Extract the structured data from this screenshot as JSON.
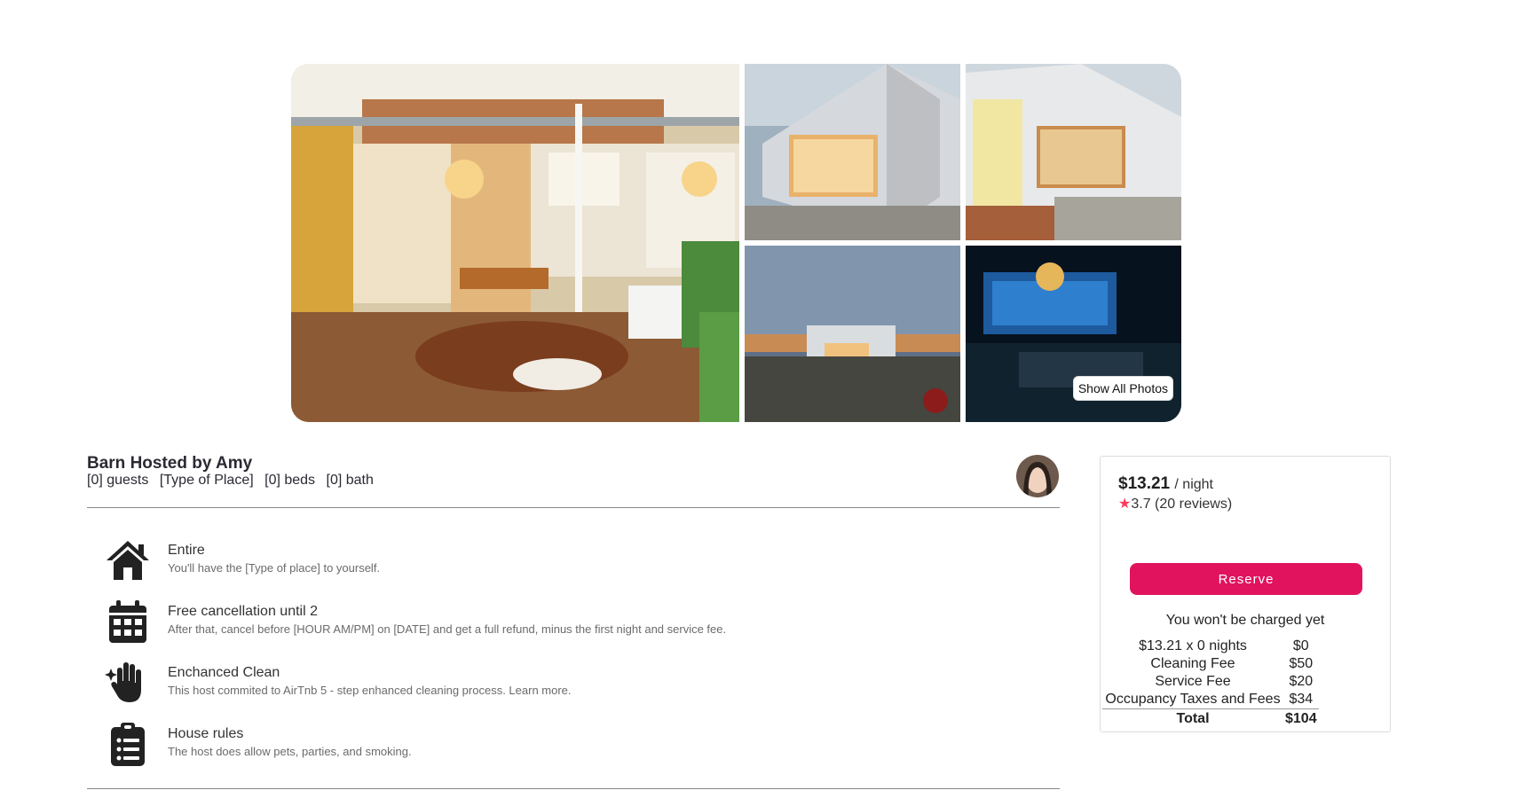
{
  "gallery": {
    "show_all_label": "Show All Photos"
  },
  "listing": {
    "title": "Barn Hosted by Amy",
    "details": [
      "[0] guests",
      "[Type of Place]",
      "[0] beds",
      "[0] bath"
    ]
  },
  "features": [
    {
      "icon": "house-icon",
      "title": "Entire",
      "desc": "You'll have the [Type of place] to yourself."
    },
    {
      "icon": "calendar-icon",
      "title": "Free cancellation until 2",
      "desc": "After that, cancel before [HOUR AM/PM] on [DATE] and get a full refund, minus the first night and service fee."
    },
    {
      "icon": "sparkle-hand-icon",
      "title": "Enchanced Clean",
      "desc": "This host commited to AirTnb 5 - step enhanced cleaning process. Learn more."
    },
    {
      "icon": "clipboard-list-icon",
      "title": "House rules",
      "desc": "The host does allow pets, parties, and smoking."
    }
  ],
  "booking": {
    "price": "$13.21",
    "per": "/ night",
    "rating": "3.7",
    "reviews": "(20 reviews)",
    "reserve_label": "Reserve",
    "no_charge": "You won't be charged yet",
    "fees": [
      {
        "label": "$13.21 x 0 nights",
        "amount": "$0"
      },
      {
        "label": "Cleaning Fee",
        "amount": "$50"
      },
      {
        "label": "Service Fee",
        "amount": "$20"
      },
      {
        "label": "Occupancy Taxes and Fees",
        "amount": "$34"
      }
    ],
    "total_label": "Total",
    "total_amount": "$104"
  },
  "colors": {
    "reserve": "#e2135e",
    "star": "#ff385c"
  }
}
